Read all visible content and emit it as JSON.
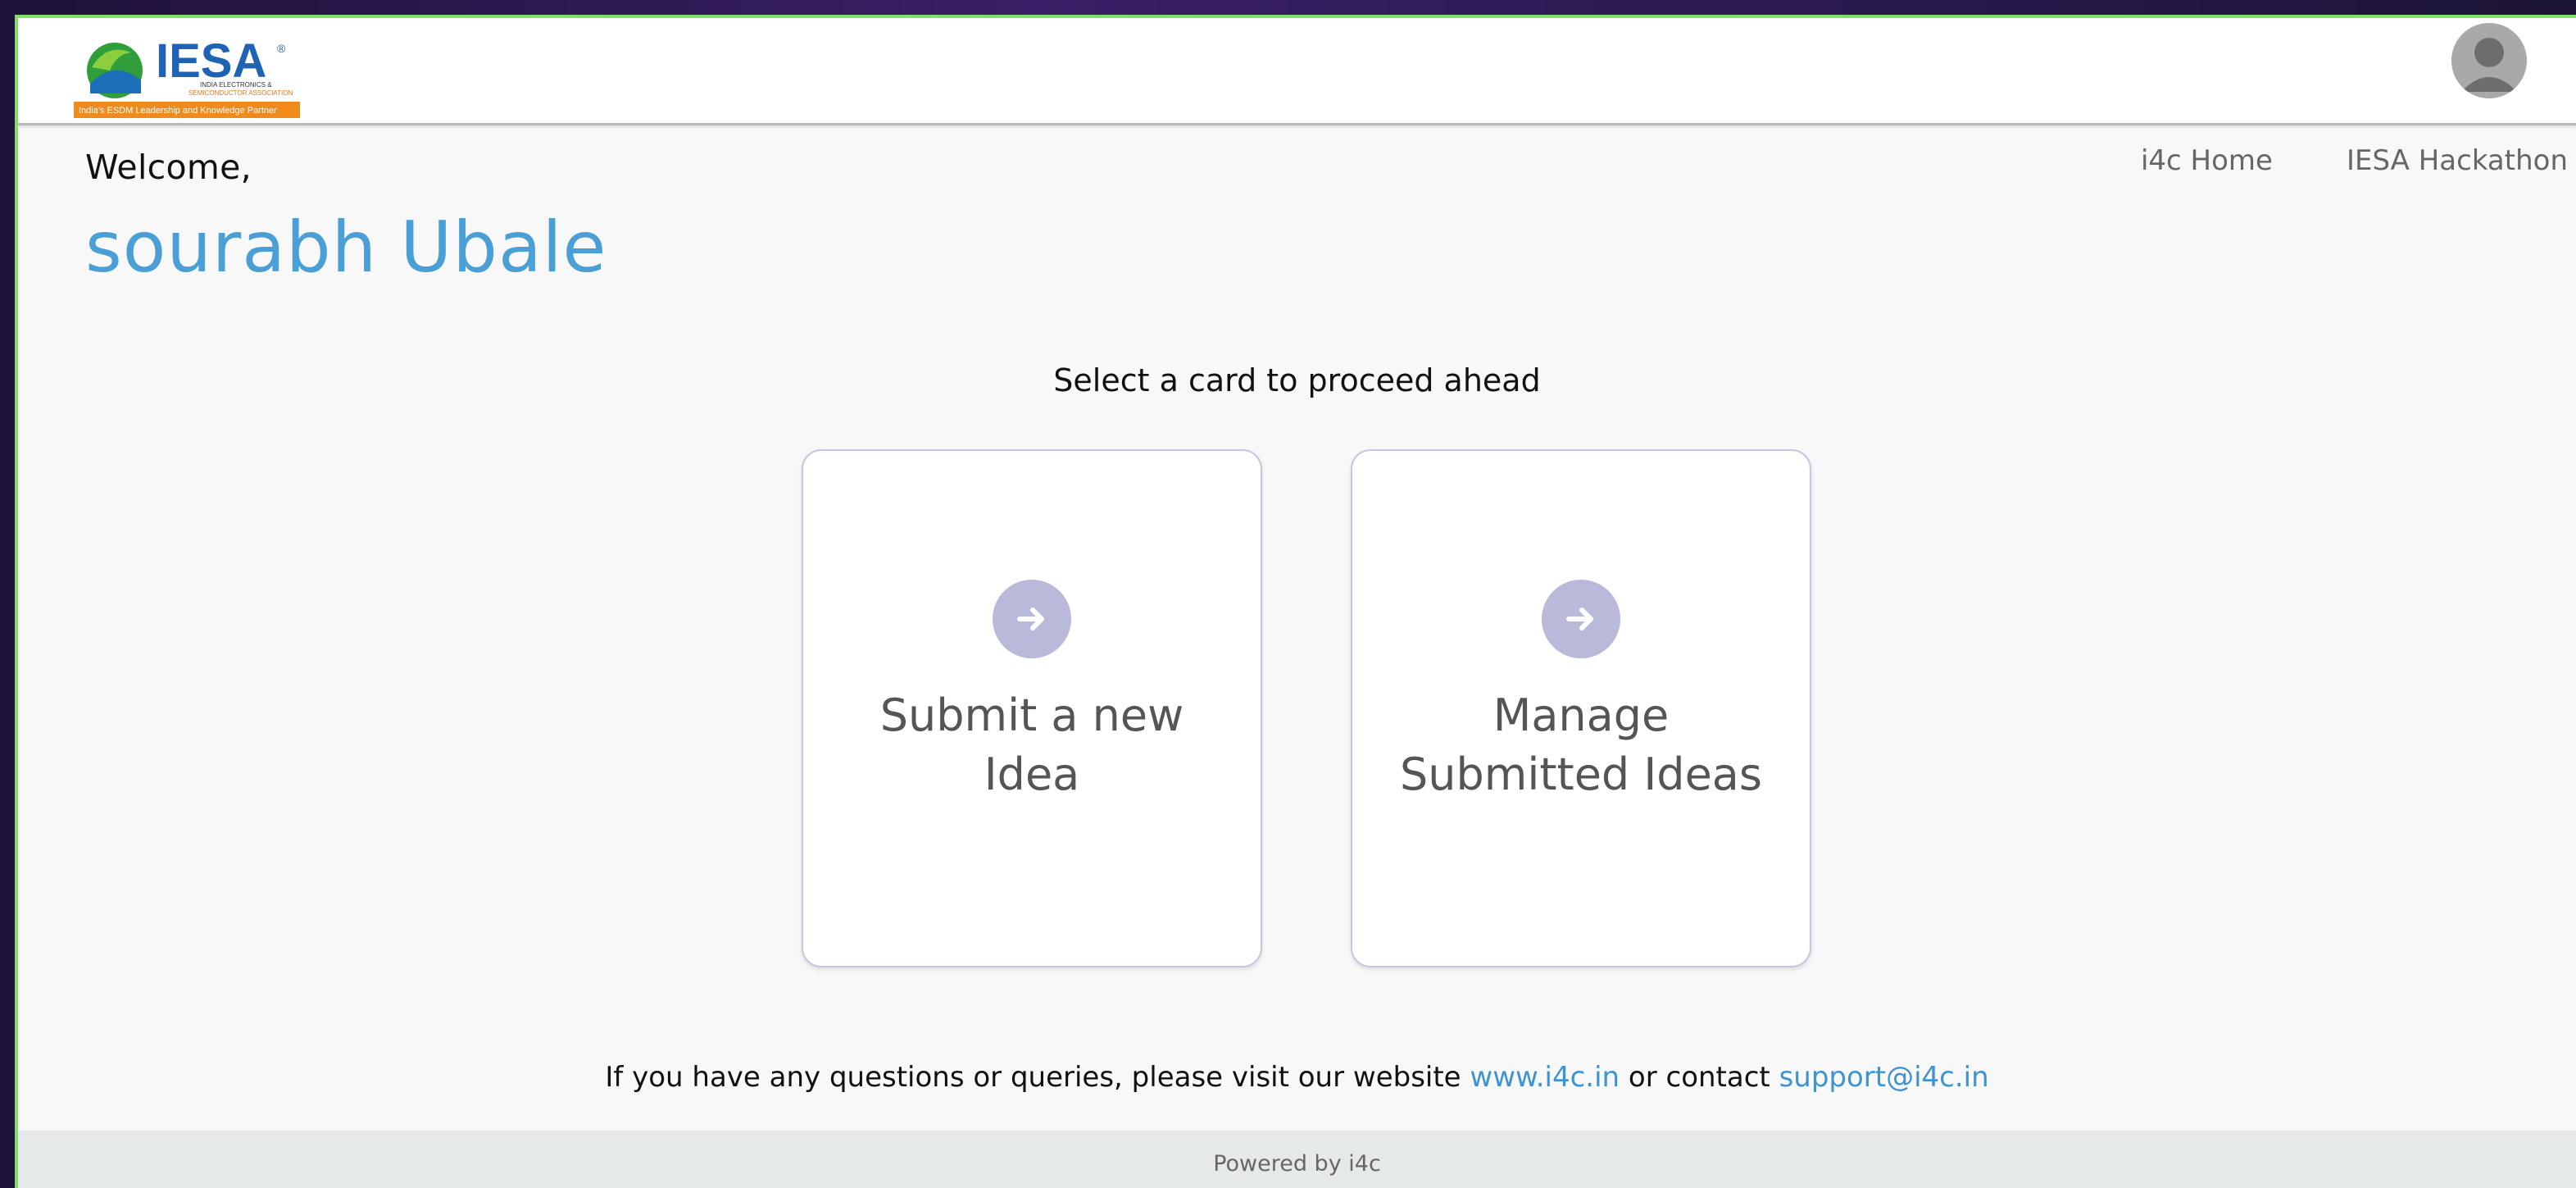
{
  "header": {
    "logo_alt": "IESA",
    "logo_line1": "INDIA ELECTRONICS &",
    "logo_line2": "SEMICONDUCTOR ASSOCIATION",
    "logo_tagline": "India's ESDM Leadership and Knowledge Partner",
    "avatar_icon": "user-avatar-icon"
  },
  "greeting": {
    "welcome": "Welcome,",
    "user_name": "sourabh Ubale"
  },
  "nav": {
    "items": [
      {
        "label": "i4c Home"
      },
      {
        "label": "IESA Hackathon"
      }
    ]
  },
  "main": {
    "prompt": "Select a card to proceed ahead",
    "cards": [
      {
        "title": "Submit a new Idea",
        "icon": "arrow-right-icon"
      },
      {
        "title": "Manage Submitted Ideas",
        "icon": "arrow-right-icon"
      }
    ]
  },
  "contact": {
    "text_before": "If you have any questions or queries, please visit our website",
    "website_link": "www.i4c.in",
    "text_middle": "or contact",
    "email_link": "support@i4c.in"
  },
  "footer": {
    "powered_by": "Powered by i4c"
  },
  "colors": {
    "accent_blue": "#4a9fd6",
    "card_icon_bg": "#b9bad9",
    "frame_border_green": "#7ee06a"
  }
}
